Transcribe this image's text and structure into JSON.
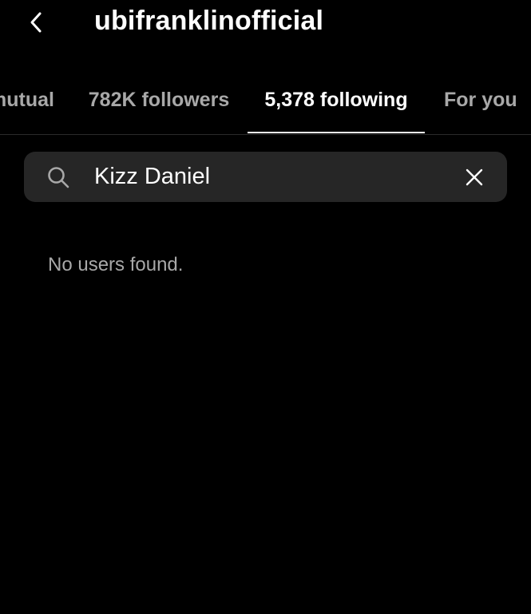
{
  "header": {
    "back_icon": "chevron-left-icon",
    "username": "ubifranklinofficial"
  },
  "tabs": [
    {
      "label": "mutual",
      "active": false
    },
    {
      "label": "782K followers",
      "active": false
    },
    {
      "label": "5,378 following",
      "active": true
    },
    {
      "label": "For you",
      "active": false
    }
  ],
  "search": {
    "icon": "search-icon",
    "value": "Kizz Daniel",
    "clear_icon": "close-icon"
  },
  "results": {
    "empty_message": "No users found."
  },
  "colors": {
    "background": "#000000",
    "text_primary": "#ffffff",
    "text_secondary": "#a8a8a8",
    "search_bg": "#262626"
  }
}
